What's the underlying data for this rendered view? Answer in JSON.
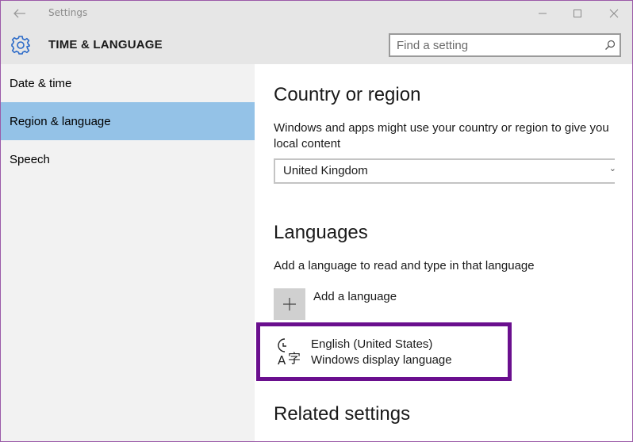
{
  "window": {
    "title": "Settings"
  },
  "header": {
    "title": "TIME & LANGUAGE",
    "search_placeholder": "Find a setting"
  },
  "sidebar": {
    "items": [
      {
        "label": "Date & time"
      },
      {
        "label": "Region & language",
        "active": true
      },
      {
        "label": "Speech"
      }
    ]
  },
  "main": {
    "country": {
      "heading": "Country or region",
      "description_line1": "Windows and apps might use your country or region to give you",
      "description_line2": "local content",
      "selected": "United Kingdom"
    },
    "languages": {
      "heading": "Languages",
      "description": "Add a language to read and type in that language",
      "add_label": "Add a language",
      "entries": [
        {
          "name": "English (United States)",
          "sub": "Windows display language"
        }
      ]
    },
    "related": {
      "heading": "Related settings"
    }
  },
  "colors": {
    "accent": "#2b6ac8",
    "sidebar_active": "#94c2e7",
    "highlight_border": "#6a0f8e",
    "window_border": "#9b5aa8"
  },
  "icons": {
    "back": "back-arrow-icon",
    "gear": "gear-icon",
    "search": "search-icon",
    "add": "plus-icon",
    "language": "language-icon"
  }
}
